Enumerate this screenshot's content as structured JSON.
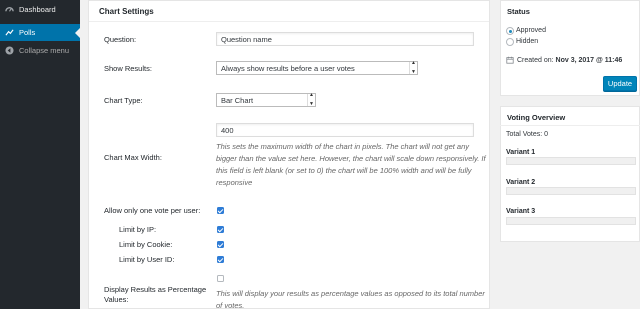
{
  "sidebar": {
    "dashboard": "Dashboard",
    "polls": "Polls",
    "collapse": "Collapse menu"
  },
  "panel": {
    "title": "Chart Settings",
    "question_label": "Question:",
    "question_value": "Question name",
    "show_results_label": "Show Results:",
    "show_results_value": "Always show results before a user votes",
    "chart_type_label": "Chart Type:",
    "chart_type_value": "Bar Chart",
    "max_width_label": "Chart Max Width:",
    "max_width_value": "400",
    "max_width_desc": "This sets the maximum width of the chart in pixels. The chart will not get any bigger than the value set here. However, the chart will scale down responsively. If this field is left blank (or set to 0) the chart will be 100% width and will be fully responsive",
    "one_vote_label": "Allow only one vote per user:",
    "limit_ip_label": "Limit by IP:",
    "limit_cookie_label": "Limit by Cookie:",
    "limit_userid_label": "Limit by User ID:",
    "percentage_label": "Display Results as Percentage Values:",
    "percentage_desc": "This will display your results as percentage values as opposed to its total number of votes."
  },
  "status": {
    "title": "Status",
    "approved": "Approved",
    "hidden": "Hidden",
    "created_on": "Created on:",
    "created_date": "Nov 3, 2017 @ 11:46",
    "update_button": "Update"
  },
  "voting": {
    "title": "Voting Overview",
    "total_votes": "Total Votes: 0",
    "variants": [
      "Variant 1",
      "Variant 2",
      "Variant 3"
    ]
  },
  "colors": {
    "sidebar_bg": "#23282d",
    "accent": "#0073aa",
    "checkbox": "#2e7cd6"
  },
  "icons": [
    "dashboard-icon",
    "polls-icon",
    "collapse-icon",
    "calendar-icon"
  ]
}
